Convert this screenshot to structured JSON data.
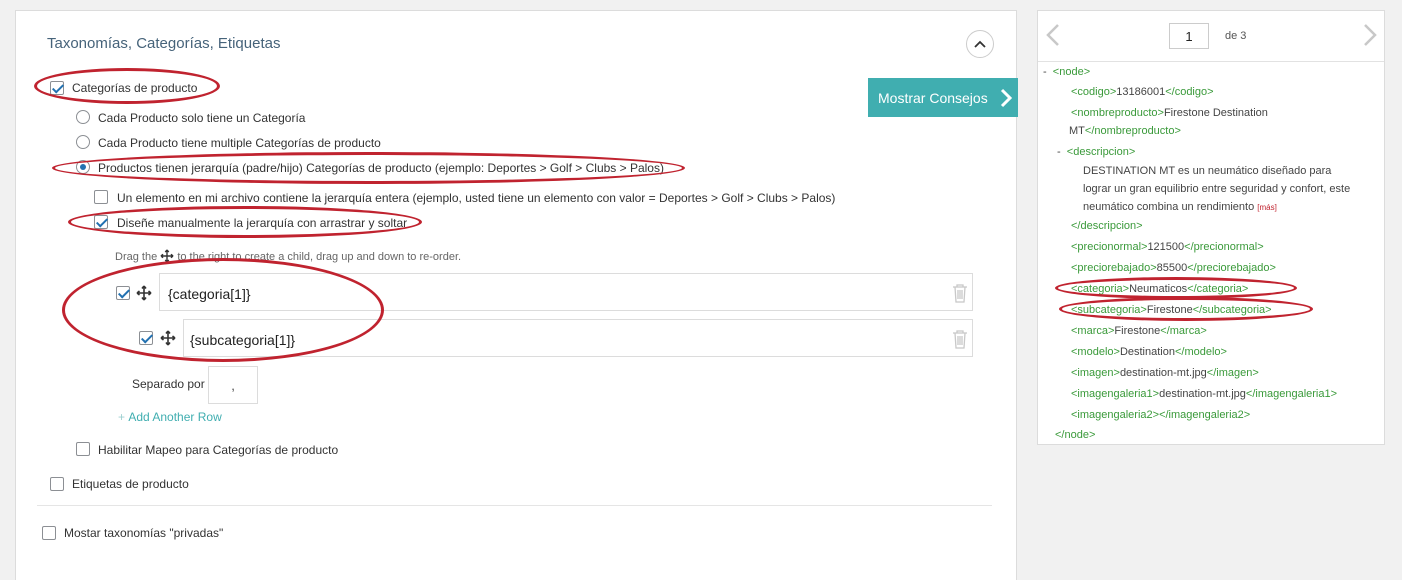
{
  "section": {
    "title": "Taxonomías, Categorías, Etiquetas",
    "tips_button": "Mostrar Consejos"
  },
  "options": {
    "product_categories": "Categorías de producto",
    "radio_single": "Cada Producto solo tiene un Categoría",
    "radio_multiple": "Cada Producto tiene multiple Categorías de producto",
    "radio_hierarchy": "Productos tienen jerarquía (padre/hijo) Categorías de producto (ejemplo: Deportes > Golf > Clubs > Palos)",
    "single_element": "Un elemento en mi archivo contiene la jerarquía entera (ejemplo, usted tiene un elemento con valor = Deportes > Golf > Clubs > Palos)",
    "manual_design": "Diseñe manualmente la jerarquía con arrastrar y soltar",
    "drag_hint_before": "Drag the",
    "drag_hint_after": "to the right to create a child, drag up and down to re-order.",
    "row1_value": "{categoria[1]}",
    "row2_value": "{subcategoria[1]}",
    "separator_label": "Separado por",
    "separator_value": ",",
    "add_row": "Add Another Row",
    "enable_mapping": "Habilitar Mapeo para Categorías de producto",
    "product_tags": "Etiquetas de producto",
    "private_taxonomies": "Mostar taxonomías \"privadas\""
  },
  "pager": {
    "page": "1",
    "of_label": "de 3"
  },
  "xml": {
    "node_open": "<node>",
    "node_close": "</node>",
    "codigo_open": "<codigo>",
    "codigo_val": "13186001",
    "codigo_close": "</codigo>",
    "nombre_open": "<nombreproducto>",
    "nombre_val1": "Firestone Destination",
    "nombre_val2": "MT",
    "nombre_close": "</nombreproducto>",
    "desc_open": "<descripcion>",
    "desc_line1": "DESTINATION MT es un neumático diseñado para",
    "desc_line2": "lograr un gran equilibrio entre seguridad y confort, este",
    "desc_line3": "neumático combina un rendimiento",
    "desc_more": "[más]",
    "desc_close": "</descripcion>",
    "precio_open": "<precionormal>",
    "precio_val": "121500",
    "precio_close": "</precionormal>",
    "rebajado_open": "<preciorebajado>",
    "rebajado_val": "85500",
    "rebajado_close": "</preciorebajado>",
    "cat_open": "<categoria>",
    "cat_val": "Neumaticos",
    "cat_close": "</categoria>",
    "subcat_open": "<subcategoria>",
    "subcat_val": "Firestone",
    "subcat_close": "</subcategoria>",
    "marca_open": "<marca>",
    "marca_val": "Firestone",
    "marca_close": "</marca>",
    "modelo_open": "<modelo>",
    "modelo_val": "Destination",
    "modelo_close": "</modelo>",
    "imagen_open": "<imagen>",
    "imagen_val": "destination-mt.jpg",
    "imagen_close": "</imagen>",
    "ig1_open": "<imagengaleria1>",
    "ig1_val": "destination-mt.jpg",
    "ig1_close": "</imagengaleria1>",
    "ig2_open": "<imagengaleria2>",
    "ig2_close": "</imagengaleria2>",
    "toggle": "-"
  },
  "colors": {
    "accent": "#40aeb0",
    "annotation": "#c0232f",
    "xml_tag": "#3a9a3a"
  }
}
